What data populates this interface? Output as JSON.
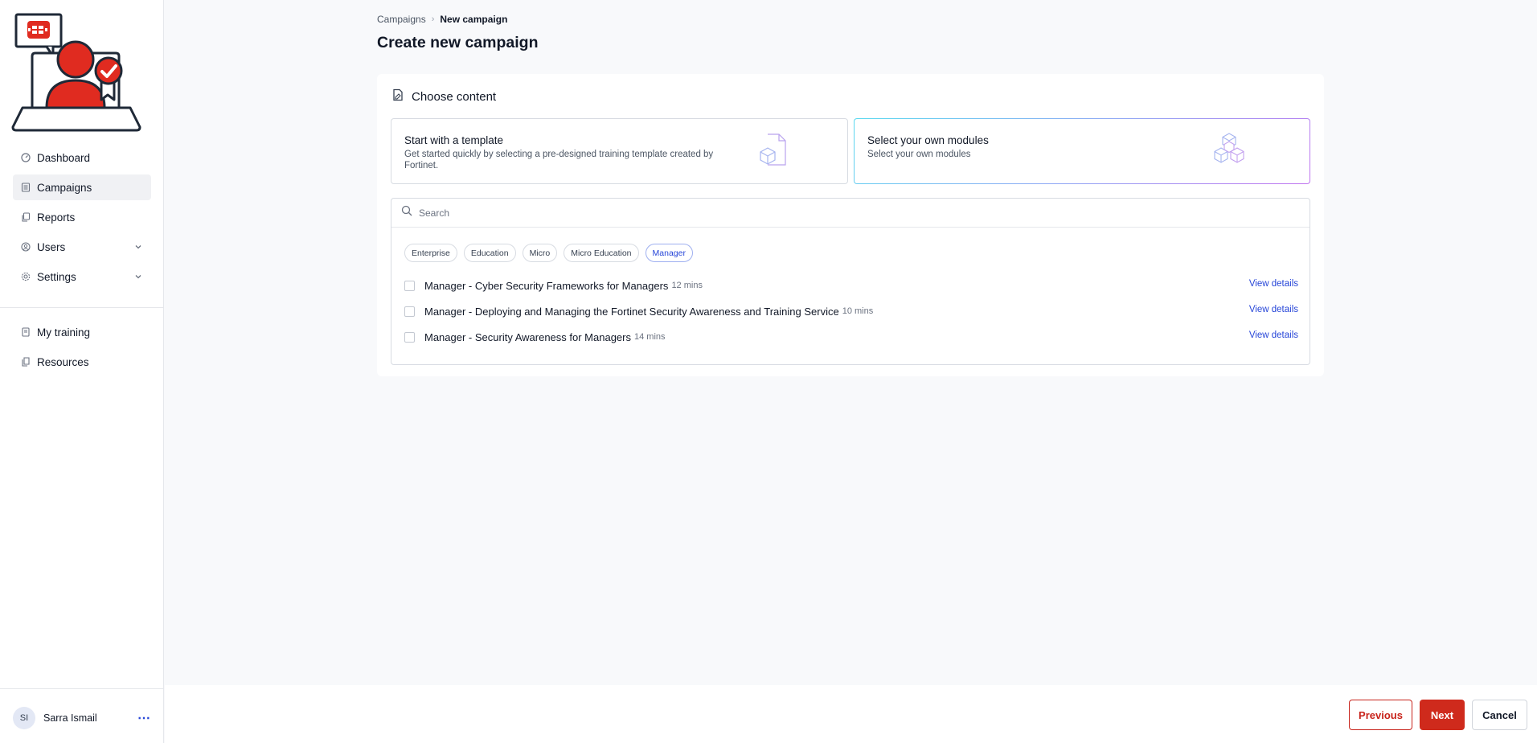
{
  "sidebar": {
    "logo_icon": "security-awareness-logo-icon",
    "items": [
      {
        "label": "Dashboard",
        "icon": "gauge-icon"
      },
      {
        "label": "Campaigns",
        "icon": "list-icon"
      },
      {
        "label": "Reports",
        "icon": "copy-icon"
      },
      {
        "label": "Users",
        "icon": "user-circle-icon"
      },
      {
        "label": "Settings",
        "icon": "gear-icon"
      }
    ],
    "secondary_items": [
      {
        "label": "My training",
        "icon": "book-icon"
      },
      {
        "label": "Resources",
        "icon": "files-icon"
      }
    ],
    "user": {
      "initials": "SI",
      "name": "Sarra Ismail",
      "menu": "⋯"
    }
  },
  "breadcrumb": {
    "parent": "Campaigns",
    "separator": "›",
    "current": "New campaign"
  },
  "page_title": "Create new campaign",
  "content": {
    "heading": "Choose content",
    "choices": [
      {
        "title": "Start with a template",
        "description": "Get started quickly by selecting a pre-designed training template created by Fortinet."
      },
      {
        "title": "Select your own modules",
        "description": "Select your own modules"
      }
    ],
    "search_placeholder": "Search",
    "filters": [
      "Enterprise",
      "Education",
      "Micro",
      "Micro Education",
      "Manager"
    ],
    "active_filter": "Manager",
    "modules": [
      {
        "title": "Manager - Cyber Security Frameworks for Managers",
        "duration": "12 mins",
        "link": "View details"
      },
      {
        "title": "Manager - Deploying and Managing the Fortinet Security Awareness and Training Service",
        "duration": "10 mins",
        "link": "View details"
      },
      {
        "title": "Manager - Security Awareness for Managers",
        "duration": "14 mins",
        "link": "View details"
      }
    ]
  },
  "footer": {
    "previous": "Previous",
    "next": "Next",
    "cancel": "Cancel"
  },
  "colors": {
    "brand_red": "#cf2a1c",
    "link_blue": "#2746d8",
    "active_nav_bg": "#f0f1f4"
  }
}
